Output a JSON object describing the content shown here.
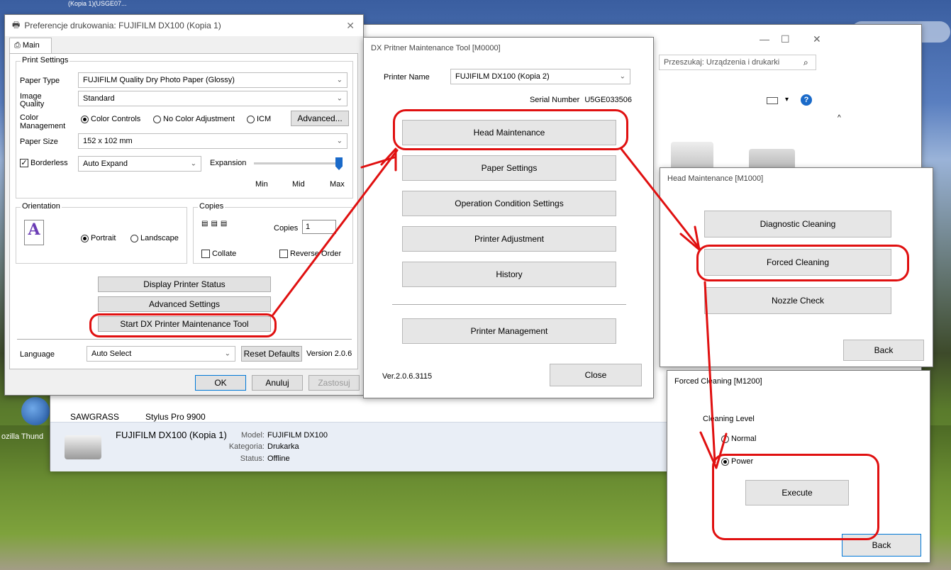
{
  "desktop": {
    "icon_label_thunderbird": "ozilla Thund",
    "partial_top_text": "(Kopia 1)(USGE07...",
    "devices_label_sawgrass": "SAWGRASS",
    "devices_label_stylus": "Stylus Pro 9900"
  },
  "devices_window": {
    "search_placeholder": "Przeszukaj: Urządzenia i drukarki",
    "printer_name": "FUJIFILM DX100 (Kopia 1)",
    "model_label": "Model:",
    "model_value": "FUJIFILM DX100",
    "category_label": "Kategoria:",
    "category_value": "Drukarka",
    "status_label": "Status:",
    "status_value": "Offline",
    "minimize": "—",
    "maximize": "☐",
    "close": "✕"
  },
  "prefs_window": {
    "title": "Preferencje drukowania: FUJIFILM DX100 (Kopia 1)",
    "tab_main": "Main",
    "group_print_settings": "Print Settings",
    "paper_type_label": "Paper Type",
    "paper_type_value": "FUJIFILM Quality Dry Photo Paper (Glossy)",
    "image_quality_label_1": "Image",
    "image_quality_label_2": "Quality",
    "image_quality_value": "Standard",
    "color_mgmt_label_1": "Color",
    "color_mgmt_label_2": "Management",
    "radio_color_controls": "Color Controls",
    "radio_no_color": "No Color Adjustment",
    "radio_icm": "ICM",
    "advanced_btn": "Advanced...",
    "paper_size_label": "Paper Size",
    "paper_size_value": "152 x 102 mm",
    "borderless_label": "Borderless",
    "borderless_mode": "Auto Expand",
    "expansion_label": "Expansion",
    "slider_min": "Min",
    "slider_mid": "Mid",
    "slider_max": "Max",
    "group_orientation": "Orientation",
    "radio_portrait": "Portrait",
    "radio_landscape": "Landscape",
    "group_copies": "Copies",
    "copies_label": "Copies",
    "copies_value": "1",
    "collate_label": "Collate",
    "reverse_order_label": "Reverse Order",
    "display_status_btn": "Display Printer Status",
    "advanced_settings_btn": "Advanced Settings",
    "start_tool_btn": "Start DX Printer Maintenance Tool",
    "language_label": "Language",
    "language_value": "Auto Select",
    "reset_defaults_btn": "Reset Defaults",
    "version_text": "Version 2.0.6",
    "ok_btn": "OK",
    "cancel_btn": "Anuluj",
    "apply_btn": "Zastosuj"
  },
  "maint_window": {
    "title": "DX Pritner Maintenance Tool [M0000]",
    "printer_name_label": "Printer Name",
    "printer_name_value": "FUJIFILM DX100 (Kopia 2)",
    "serial_label": "Serial Number",
    "serial_value": "U5GE033506",
    "btn_head": "Head Maintenance",
    "btn_paper": "Paper Settings",
    "btn_operation": "Operation Condition Settings",
    "btn_adjustment": "Printer Adjustment",
    "btn_history": "History",
    "btn_management": "Printer Management",
    "version": "Ver.2.0.6.3115",
    "close_btn": "Close"
  },
  "head_window": {
    "title": "Head Maintenance [M1000]",
    "btn_diagnostic": "Diagnostic Cleaning",
    "btn_forced": "Forced Cleaning",
    "btn_nozzle": "Nozzle Check",
    "back_btn": "Back"
  },
  "forced_window": {
    "title": "Forced Cleaning [M1200]",
    "level_label": "Cleaning Level",
    "radio_normal": "Normal",
    "radio_power": "Power",
    "execute_btn": "Execute",
    "back_btn": "Back"
  },
  "annotation": {
    "color": "#e01010"
  }
}
